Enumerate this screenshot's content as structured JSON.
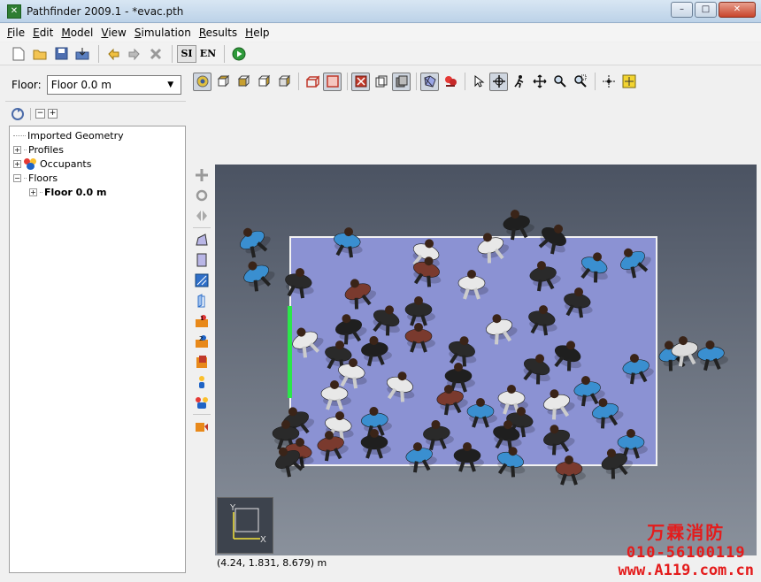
{
  "window": {
    "title": "Pathfinder 2009.1 - *evac.pth",
    "app_icon": "pathfinder-app-icon",
    "controls": {
      "minimize": "–",
      "maximize": "□",
      "close": "✕"
    }
  },
  "menu": [
    "File",
    "Edit",
    "Model",
    "View",
    "Simulation",
    "Results",
    "Help"
  ],
  "toolbar": {
    "unit_si": "SI",
    "unit_en": "EN"
  },
  "left_panel": {
    "floor_label": "Floor:",
    "floor_value": "Floor 0.0 m",
    "tree": [
      {
        "label": "Imported Geometry",
        "expandable": false,
        "bold": false
      },
      {
        "label": "Profiles",
        "expandable": true,
        "bold": false
      },
      {
        "label": "Occupants",
        "expandable": true,
        "bold": false,
        "icon": "occupants-icon"
      },
      {
        "label": "Floors",
        "expandable": true,
        "bold": false
      },
      {
        "label": "Floor 0.0 m",
        "expandable": true,
        "bold": true,
        "indent": 1
      }
    ]
  },
  "viewport": {
    "floor_color": "#8b92d3",
    "exit_color": "#2be64a",
    "axis_labels": {
      "y": "Y",
      "x": "X"
    }
  },
  "status": {
    "coordinates": "(4.24, 1.831, 8.679) m"
  },
  "watermark": {
    "line1": "万霖消防",
    "line2": "010-56100119",
    "line3": "www.A119.com.cn",
    "color": "#e41c1c"
  }
}
